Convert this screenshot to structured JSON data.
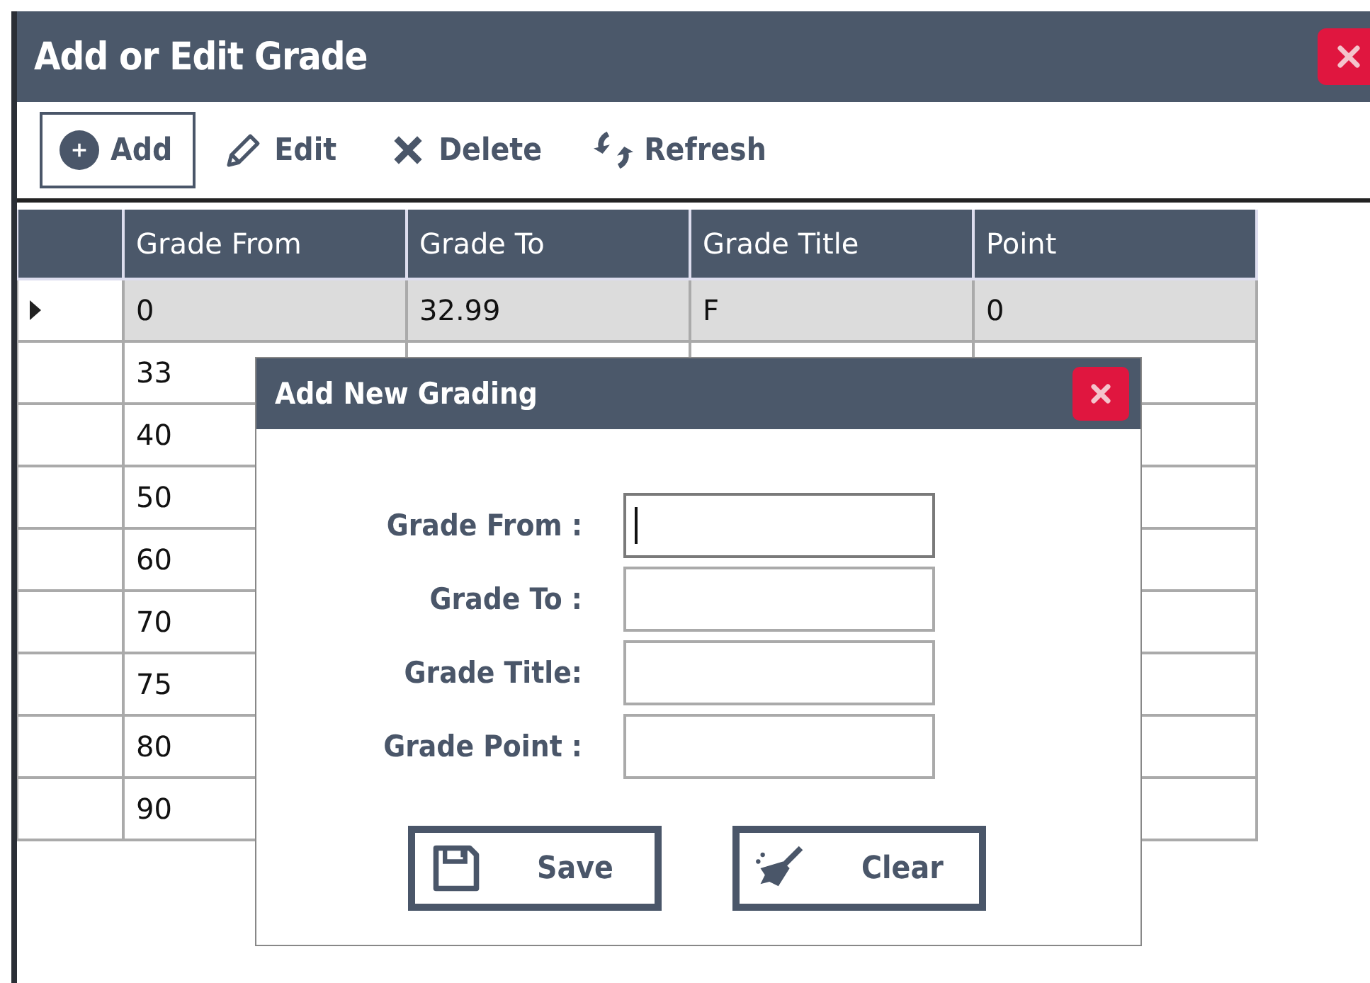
{
  "window": {
    "title": "Add or Edit Grade"
  },
  "toolbar": [
    {
      "kind": "add",
      "label": "Add",
      "focused": true
    },
    {
      "kind": "edit",
      "label": "Edit",
      "focused": false
    },
    {
      "kind": "delete",
      "label": "Delete",
      "focused": false
    },
    {
      "kind": "refresh",
      "label": "Refresh",
      "focused": false
    }
  ],
  "table": {
    "columns": [
      "Grade From",
      "Grade To",
      "Grade Title",
      "Point"
    ],
    "rows": [
      {
        "selected": true,
        "cells": [
          "0",
          "32.99",
          "F",
          "0"
        ]
      },
      {
        "selected": false,
        "cells": [
          "33"
        ]
      },
      {
        "selected": false,
        "cells": [
          "40"
        ]
      },
      {
        "selected": false,
        "cells": [
          "50"
        ]
      },
      {
        "selected": false,
        "cells": [
          "60"
        ]
      },
      {
        "selected": false,
        "cells": [
          "70"
        ]
      },
      {
        "selected": false,
        "cells": [
          "75"
        ]
      },
      {
        "selected": false,
        "cells": [
          "80"
        ]
      },
      {
        "selected": false,
        "cells": [
          "90"
        ]
      }
    ]
  },
  "dialog": {
    "title": "Add New Grading",
    "fields": [
      {
        "label": "Grade From :",
        "focused": true
      },
      {
        "label": "Grade To :",
        "focused": false
      },
      {
        "label": "Grade Title:",
        "focused": false
      },
      {
        "label": "Grade Point :",
        "focused": false
      }
    ],
    "buttons": [
      {
        "kind": "save",
        "label": "Save"
      },
      {
        "kind": "clear",
        "label": "Clear"
      }
    ]
  }
}
